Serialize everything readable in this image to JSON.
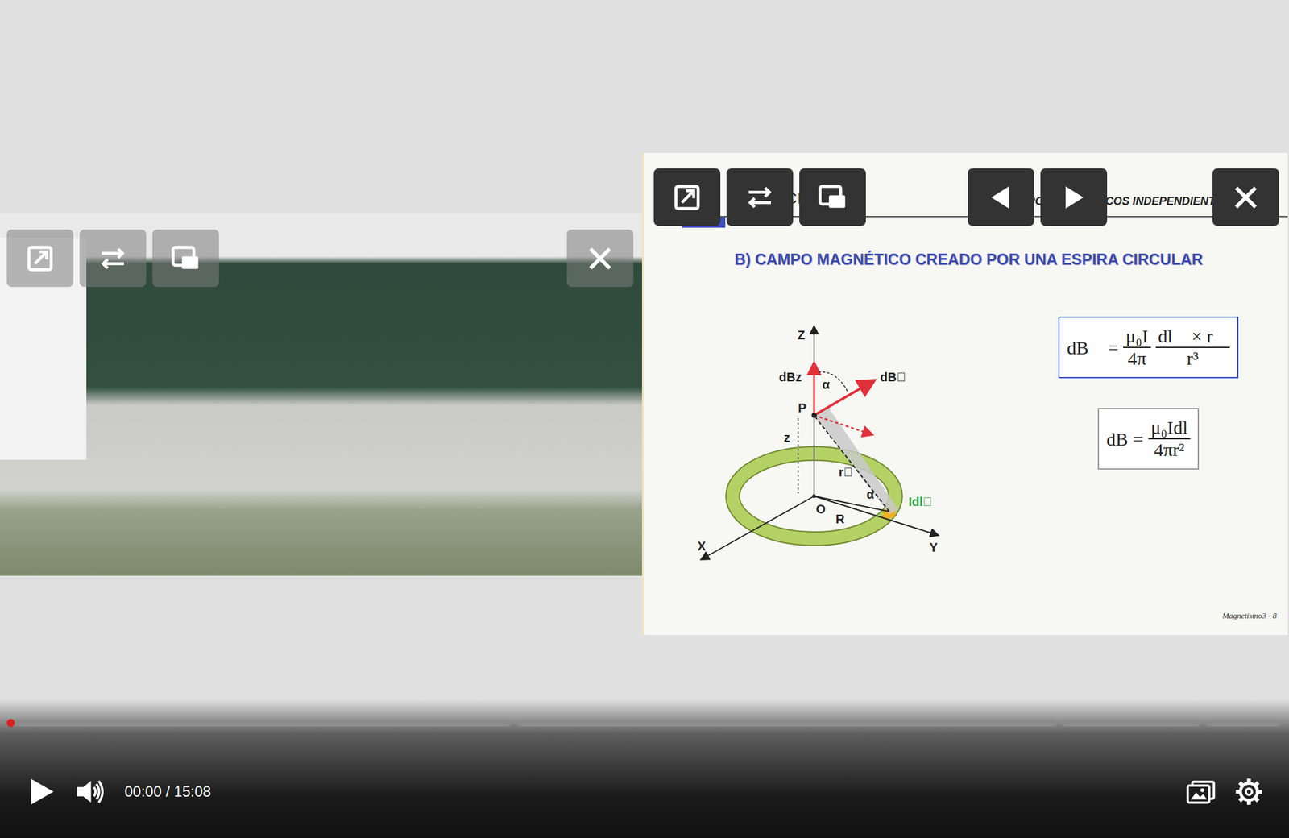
{
  "slide": {
    "header_left": "LECCIÓ",
    "header_right": "CAMPOS MAGNÉTICOS INDEPENDIENTES DEL TIE",
    "title": "B) CAMPO MAGNÉTICO CREADO POR UNA ESPIRA CIRCULAR",
    "diagram": {
      "labels": {
        "axis_z": "Z",
        "dBz": "dBz",
        "alpha_top": "α",
        "dB": "dB⃗",
        "point_p": "P",
        "height": "z",
        "r_vec": "r⃗",
        "alpha_bottom": "α",
        "origin": "O",
        "radius": "R",
        "Idl": "Idl⃗",
        "axis_x": "X",
        "axis_y": "Y"
      }
    },
    "formulas": [
      {
        "lhs": "dB⃗",
        "eq": "=",
        "fractions": [
          {
            "num": "μ₀I",
            "den": "4π"
          },
          {
            "num": "dl⃗ × r⃗",
            "den": "r³"
          }
        ],
        "color": "#3a4fc4"
      },
      {
        "lhs": "dB",
        "eq": "=",
        "fractions": [
          {
            "num": "μ₀Idl",
            "den": "4πr²"
          }
        ],
        "color": "#9a9a9a"
      }
    ],
    "footer": "Magnetismo3 - 8"
  },
  "player": {
    "playing": false,
    "muted": false,
    "time": "00:00 / 15:08",
    "progress": {
      "level": 0,
      "chapters": [
        {
          "share": 0.4
        },
        {
          "share": 0.43
        },
        {
          "share": 0.11
        },
        {
          "share": 0.06
        }
      ]
    }
  }
}
